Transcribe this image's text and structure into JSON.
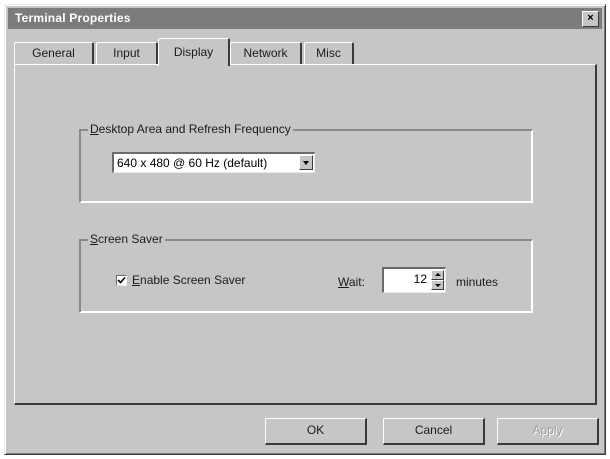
{
  "window": {
    "title": "Terminal Properties",
    "close_glyph": "×"
  },
  "tabs": [
    {
      "label": "General",
      "active": false
    },
    {
      "label": "Input",
      "active": false
    },
    {
      "label": "Display",
      "active": true
    },
    {
      "label": "Network",
      "active": false
    },
    {
      "label": "Misc",
      "active": false
    }
  ],
  "desktop_group": {
    "label_prefix": "",
    "label_accel": "D",
    "label_rest": "esktop Area and Refresh Frequency",
    "resolution_value": "640 x 480 @ 60 Hz (default)"
  },
  "screensaver_group": {
    "label_accel": "S",
    "label_rest": "creen Saver",
    "enable_checked": true,
    "enable_label_accel": "E",
    "enable_label_rest": "nable Screen Saver",
    "wait_label_accel": "W",
    "wait_label_rest": "ait:",
    "wait_value": "12",
    "wait_unit": "minutes"
  },
  "buttons": {
    "ok": "OK",
    "cancel": "Cancel",
    "apply": "Apply"
  },
  "colors": {
    "face": "#c6c6c6",
    "titlebar": "#7c7c7c"
  }
}
